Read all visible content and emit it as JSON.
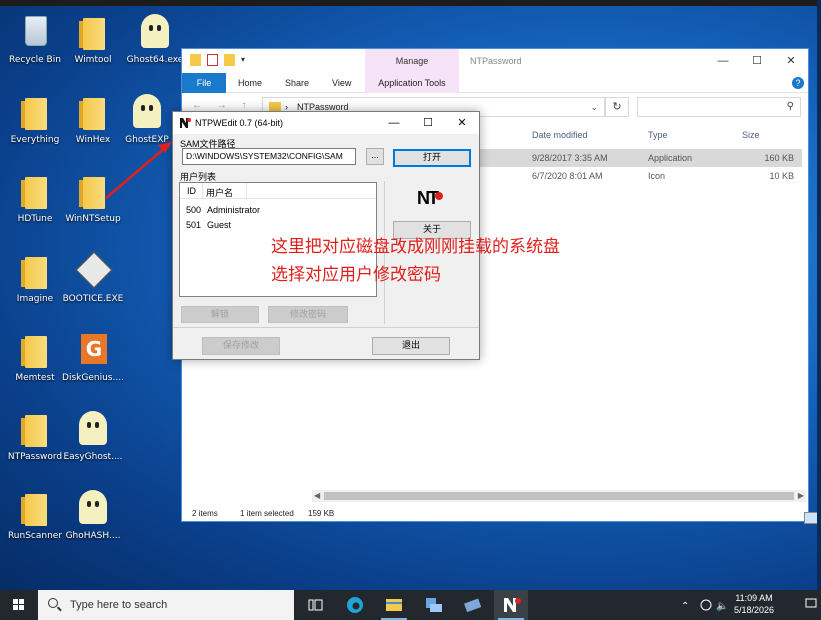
{
  "desktop_icons": [
    {
      "label": "Recycle Bin",
      "icon": "recycle-bin-icon"
    },
    {
      "label": "Wimtool",
      "icon": "folder-icon"
    },
    {
      "label": "Ghost64.exe",
      "icon": "ghost-icon"
    },
    {
      "label": "Everything",
      "icon": "folder-icon"
    },
    {
      "label": "WinHex",
      "icon": "folder-icon"
    },
    {
      "label": "GhostEXP",
      "icon": "ghost-explorer-icon"
    },
    {
      "label": "HDTune",
      "icon": "folder-icon"
    },
    {
      "label": "WinNTSetup",
      "icon": "folder-icon"
    },
    {
      "label": "Imagine",
      "icon": "folder-icon"
    },
    {
      "label": "BOOTICE.EXE",
      "icon": "floppy-icon"
    },
    {
      "label": "Memtest",
      "icon": "folder-icon"
    },
    {
      "label": "DiskGenius....",
      "icon": "diskgenius-icon"
    },
    {
      "label": "NTPassword",
      "icon": "folder-icon"
    },
    {
      "label": "EasyGhost....",
      "icon": "ghost-icon"
    },
    {
      "label": "RunScanner",
      "icon": "folder-icon"
    },
    {
      "label": "GhoHASH....",
      "icon": "ghost-hash-icon"
    }
  ],
  "explorer": {
    "title": "NTPassword",
    "manage_tab": "Manage",
    "tabs": [
      "File",
      "Home",
      "Share",
      "View"
    ],
    "app_tools": "Application Tools",
    "address": "NTPassword",
    "columns": [
      "Date modified",
      "Type",
      "Size"
    ],
    "rows": [
      {
        "date": "9/28/2017 3:35 AM",
        "type": "Application",
        "size": "160 KB"
      },
      {
        "date": "6/7/2020 8:01 AM",
        "type": "Icon",
        "size": "10 KB"
      }
    ],
    "status": {
      "items": "2 items",
      "selected": "1 item selected",
      "size": "159 KB"
    }
  },
  "ntpwedit": {
    "title": "NTPWEdit 0.7 (64-bit)",
    "sam_label": "SAM文件路径",
    "sam_path": "D:\\WINDOWS\\SYSTEM32\\CONFIG\\SAM",
    "browse_label": "...",
    "open_label": "打开",
    "userlist_label": "用户列表",
    "columns": {
      "id": "ID",
      "name": "用户名"
    },
    "users": [
      {
        "id": "500",
        "name": "Administrator"
      },
      {
        "id": "501",
        "name": "Guest"
      }
    ],
    "about_label": "关于",
    "unlock_label": "解锁",
    "change_pw_label": "修改密码",
    "save_label": "保存修改",
    "exit_label": "退出",
    "logo_text": "NT"
  },
  "annotation": {
    "line1": "这里把对应磁盘改成刚刚挂载的系统盘",
    "line2": "选择对应用户修改密码",
    "color": "#e0201c"
  },
  "taskbar": {
    "search_placeholder": "Type here to search",
    "time": "11:09 AM",
    "date": "5/18/2026"
  }
}
